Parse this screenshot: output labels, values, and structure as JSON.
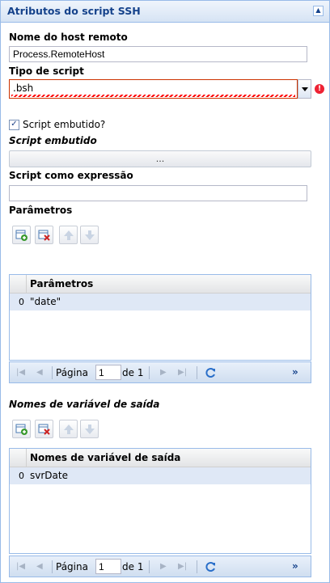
{
  "panel": {
    "title": "Atributos do script SSH",
    "collapse_icon": "collapse-up-icon"
  },
  "fields": {
    "remote_host_label": "Nome do host remoto",
    "remote_host_value": "Process.RemoteHost",
    "script_type_label": "Tipo de script",
    "script_type_value": ".bsh",
    "script_embedded_checkbox_label": "Script embutido?",
    "script_embedded_checked": true,
    "script_embedded_label": "Script embutido",
    "script_embedded_button": "...",
    "script_expression_label": "Script como expressão",
    "script_expression_value": ""
  },
  "parameters": {
    "section_label": "Parâmetros",
    "column_header": "Parâmetros",
    "rows": [
      {
        "index": "0",
        "value": "\"date\""
      }
    ],
    "pager": {
      "page_label": "Página",
      "page_value": "1",
      "of_label": "de 1",
      "more": "»"
    }
  },
  "output_vars": {
    "section_label": "Nomes de variável de saída",
    "column_header": "Nomes de variável de saída",
    "rows": [
      {
        "index": "0",
        "value": "svrDate"
      }
    ],
    "pager": {
      "page_label": "Página",
      "page_value": "1",
      "of_label": "de 1",
      "more": "»"
    }
  },
  "colors": {
    "header_text": "#15428b",
    "border": "#99bbe8",
    "selected_row": "#dfe8f6",
    "error": "#e23"
  }
}
